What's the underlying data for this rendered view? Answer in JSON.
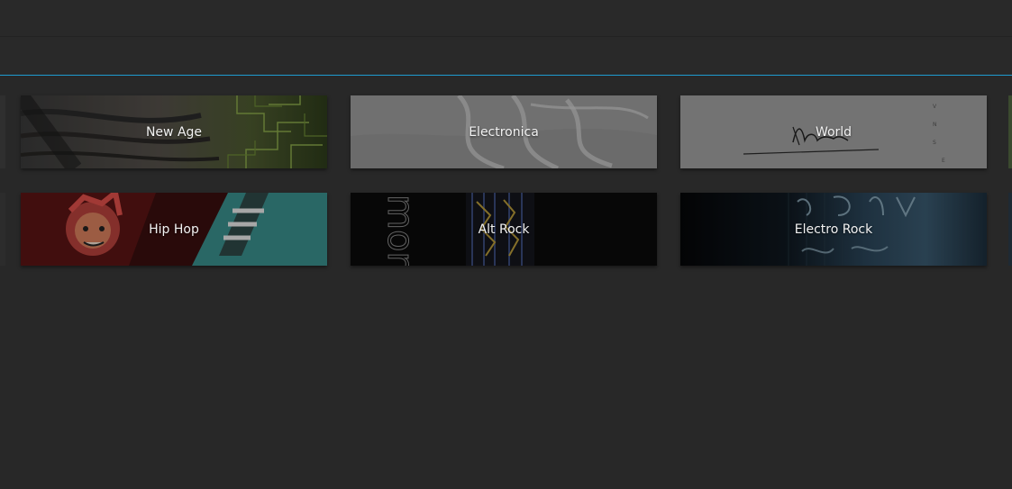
{
  "genres": [
    {
      "label": "New Age"
    },
    {
      "label": "Electronica"
    },
    {
      "label": "World"
    },
    {
      "label": "Hip Hop"
    },
    {
      "label": "Alt Rock"
    },
    {
      "label": "Electro Rock"
    }
  ],
  "art_text": {
    "alt_rock": "mor"
  },
  "colors": {
    "background": "#282828",
    "accent_line": "#1f9bd0"
  }
}
